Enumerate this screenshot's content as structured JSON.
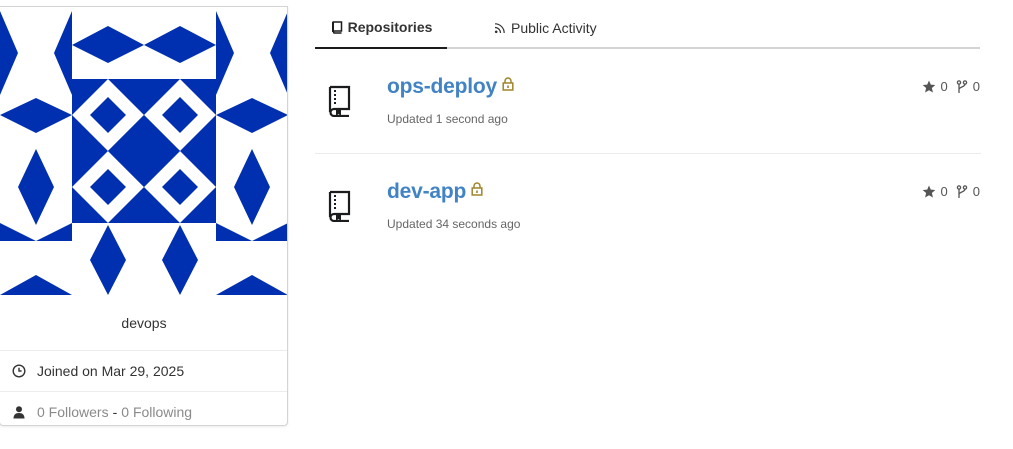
{
  "profile": {
    "username": "devops",
    "joined_text": "Joined on Mar 29, 2025",
    "followers_text": "0 Followers",
    "separator": "-",
    "following_text": "0 Following",
    "avatar_color": "#0030b0"
  },
  "tabs": [
    {
      "label": "Repositories",
      "icon": "book-icon",
      "active": true
    },
    {
      "label": "Public Activity",
      "icon": "rss-icon",
      "active": false
    }
  ],
  "repos": [
    {
      "name": "ops-deploy",
      "private": true,
      "updated": "Updated 1 second ago",
      "stars": "0",
      "forks": "0"
    },
    {
      "name": "dev-app",
      "private": true,
      "updated": "Updated 34 seconds ago",
      "stars": "0",
      "forks": "0"
    }
  ],
  "colors": {
    "link": "#4183c4",
    "lock": "#a0842a",
    "muted": "#8a8a8a"
  }
}
